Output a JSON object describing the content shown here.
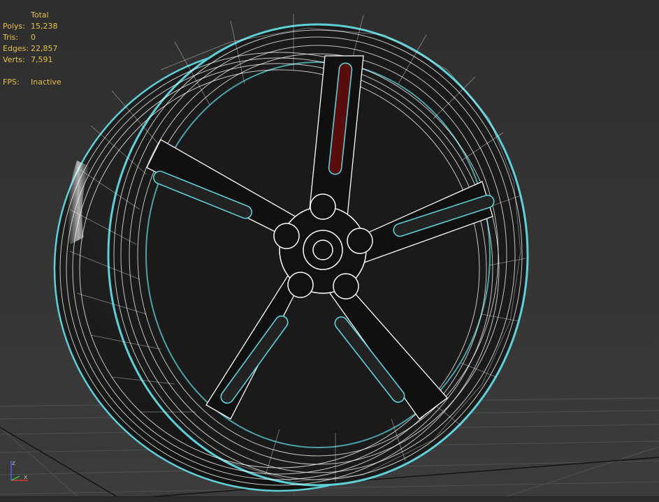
{
  "stats": {
    "header": "Total",
    "rows": [
      {
        "label": "Polys:",
        "value": "15,238"
      },
      {
        "label": "Tris:",
        "value": "0"
      },
      {
        "label": "Edges:",
        "value": "22,857"
      },
      {
        "label": "Verts:",
        "value": "7,591"
      }
    ],
    "fps": {
      "label": "FPS:",
      "value": "Inactive"
    }
  },
  "gizmo": {
    "z_label": "z",
    "x_label": "x"
  },
  "colors": {
    "stats_text": "#e6c04a",
    "selection_outline": "#5fd0d8",
    "wire": "#ffffff",
    "background": "#3a3a3a",
    "grid": "#555555",
    "accent_red": "#7a1010"
  },
  "viewport": {
    "object": "wheel-rim-wireframe",
    "shading": "wireframe-over-shaded",
    "selected": true
  }
}
